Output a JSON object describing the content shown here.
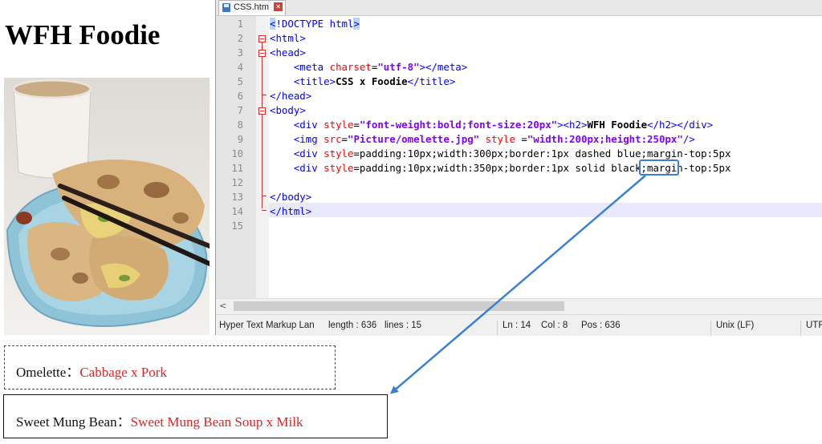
{
  "page": {
    "title": "WFH Foodie",
    "boxes": [
      {
        "label": "Omelette：",
        "value": "Cabbage x Pork"
      },
      {
        "label": "Sweet Mung Bean：",
        "value": "Sweet Mung Bean Soup x Milk"
      }
    ]
  },
  "editor": {
    "tab_name": "CSS.htm",
    "tab_icon": "save-disk-icon",
    "close_icon": "close-icon",
    "line_numbers": [
      "1",
      "2",
      "3",
      "4",
      "5",
      "6",
      "7",
      "8",
      "9",
      "10",
      "11",
      "12",
      "13",
      "14",
      "15"
    ],
    "lines": [
      "<!DOCTYPE html>",
      "<html>",
      "<head>",
      "    <meta charset=\"utf-8\"></meta>",
      "    <title>CSS x Foodie</title>",
      "</head>",
      "<body>",
      "    <div style=\"font-weight:bold;font-size:20px\"><h2>WFH Foodie</h2></div>",
      "    <img src=\"Picture/omelette.jpg\" style =\"width:200px;height:250px\"/>",
      "    <div style=\"padding:10px;width:300px;border:1px dashed blue;margin-top:5px",
      "    <div style=\"padding:10px;width:350px;border:1px solid black;margin-top:5px",
      "",
      "</body>",
      "</html>",
      ""
    ],
    "highlight_word": "solid",
    "status": {
      "language": "Hyper Text Markup Lan",
      "length": "length : 636",
      "lines": "lines : 15",
      "ln": "Ln : 14",
      "col": "Col : 8",
      "pos": "Pos : 636",
      "eol": "Unix (LF)",
      "encoding": "UTF"
    }
  },
  "colors": {
    "tag": "#0000ff",
    "attribute": "#ff0000",
    "string": "#8000ff",
    "annotation": "#3b7fd4",
    "dashed_border": "#3344cc",
    "red_text": "#d8262a"
  }
}
